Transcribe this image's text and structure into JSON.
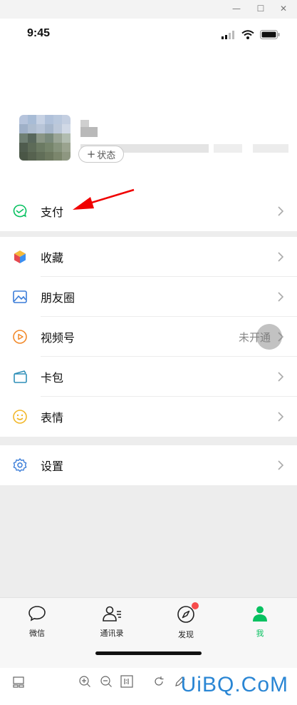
{
  "window": {
    "controls": {
      "minimize": "—",
      "maximize": "☐",
      "close": "✕"
    }
  },
  "status_bar": {
    "time": "9:45"
  },
  "profile": {
    "status_button": "状态"
  },
  "menu": {
    "pay": {
      "label": "支付",
      "icon": "pay-icon"
    },
    "favorites": {
      "label": "收藏",
      "icon": "cube-icon"
    },
    "moments": {
      "label": "朋友圈",
      "icon": "image-icon"
    },
    "channels": {
      "label": "视频号",
      "icon": "play-icon",
      "value": "未开通"
    },
    "cards": {
      "label": "卡包",
      "icon": "card-icon"
    },
    "stickers": {
      "label": "表情",
      "icon": "smile-icon"
    },
    "settings": {
      "label": "设置",
      "icon": "gear-icon"
    }
  },
  "tabbar": {
    "chats": "微信",
    "contacts": "通讯录",
    "discover": "发现",
    "me": "我"
  },
  "colors": {
    "accent": "#07c160",
    "badge": "#f74c4c",
    "arrow": "#f00000"
  },
  "watermark": "UiBQ.CoM"
}
